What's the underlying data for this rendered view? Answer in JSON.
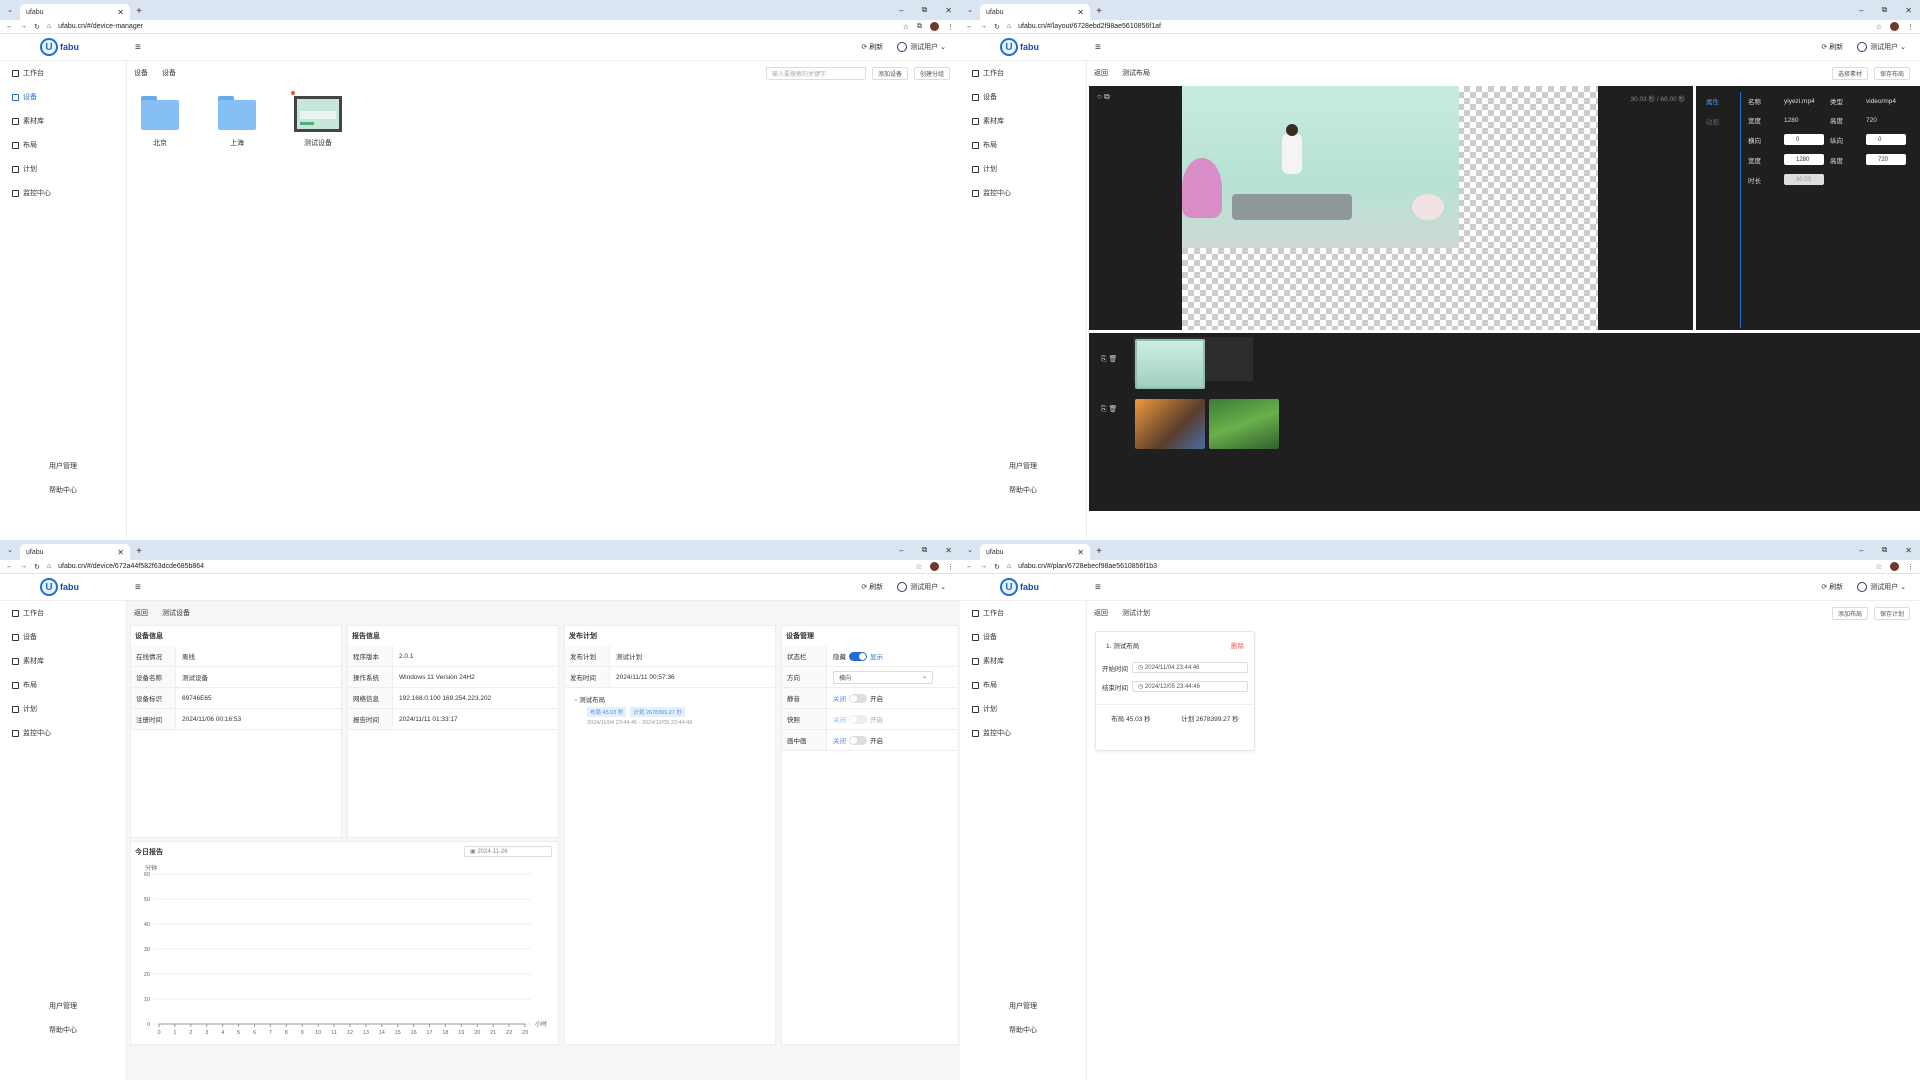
{
  "browser": {
    "tab_title": "ufabu",
    "window_controls": [
      "–",
      "⧉",
      "✕"
    ],
    "new_tab": "+"
  },
  "urls": {
    "w1": "ufabu.cn/#/device-manager",
    "w2": "ufabu.cn/#/layout/6728ebd2f98ae5610856f1af",
    "w3": "ufabu.cn/#/device/672a44f582f63dcde685b864",
    "w4": "ufabu.cn/#/plan/6728ebecf98ae5610856f1b3"
  },
  "app": {
    "logo_letter": "U",
    "logo_text": "fabu",
    "refresh": "刷新",
    "user": "测试用户",
    "sidebar": [
      "工作台",
      "设备",
      "素材库",
      "布局",
      "计划",
      "监控中心"
    ],
    "user_mgmt": "用户管理",
    "help": "帮助中心"
  },
  "w1": {
    "crumbs": [
      "设备",
      "设备"
    ],
    "search_placeholder": "输入要搜索的关键字",
    "add_device": "添加设备",
    "create_group": "创建分组",
    "items": [
      "北京",
      "上海",
      "测试设备"
    ]
  },
  "w2": {
    "crumbs": [
      "返回",
      "测试布局"
    ],
    "select_material": "选择素材",
    "save_layout": "保存布局",
    "play_time": "30.03 秒 / 60.00 秒",
    "tab_attr": "属性",
    "tab_anim": "动画",
    "props": {
      "name_k": "名称",
      "name_v": "yiyezi.mp4",
      "type_k": "类型",
      "type_v": "video/mp4",
      "w_k": "宽度",
      "w_v": "1280",
      "h_k": "高度",
      "h_v": "720",
      "x_k": "横向",
      "x_v": "0",
      "y_k": "纵向",
      "y_v": "0",
      "w2_k": "宽度",
      "w2_v": "1280",
      "h2_k": "高度",
      "h2_v": "720",
      "dur_k": "时长",
      "dur_v": "30.03"
    }
  },
  "w3": {
    "crumbs": [
      "返回",
      "测试设备"
    ],
    "device_info": {
      "title": "设备信息",
      "rows": [
        [
          "在线情况",
          "离线"
        ],
        [
          "设备名称",
          "测试设备"
        ],
        [
          "设备标识",
          "69746E65"
        ],
        [
          "注册时间",
          "2024/11/06 00:16:53"
        ]
      ]
    },
    "report_info": {
      "title": "报告信息",
      "rows": [
        [
          "程序版本",
          "2.0.1"
        ],
        [
          "操作系统",
          "Windows 11 Version 24H2"
        ],
        [
          "网络信息",
          "192.168.0.100 169.254.223.202"
        ],
        [
          "报告时间",
          "2024/11/11 01:33:17"
        ]
      ]
    },
    "publish": {
      "title": "发布计划",
      "rows": [
        [
          "发布计划",
          "测试计划"
        ],
        [
          "发布时间",
          "2024/11/11 00:57:36"
        ]
      ],
      "layout_name": "测试布局",
      "tag1": "布局 45.03 秒",
      "tag2": "计划 2678399.27 秒",
      "range": "2024/11/04 23:44:46 - 2024/12/05 23:44:46"
    },
    "manage": {
      "title": "设备管理",
      "status_k": "状态栏",
      "status_off": "隐藏",
      "status_on": "显示",
      "dir_k": "方向",
      "dir_v": "横向",
      "mute_k": "静音",
      "shot_k": "快照",
      "winmode_k": "画中画",
      "off": "关闭",
      "on": "开启"
    },
    "today": {
      "title": "今日报告",
      "date": "2024-11-26",
      "yunit": "分钟",
      "xunit": "小时"
    }
  },
  "w4": {
    "crumbs": [
      "返回",
      "测试计划"
    ],
    "add_layout": "添加布局",
    "save_plan": "保存计划",
    "card_title": "1. 测试布局",
    "delete": "删除",
    "start_k": "开始时间",
    "start_v": "2024/11/04 23:44:46",
    "end_k": "结束时间",
    "end_v": "2024/12/05 23:44:46",
    "layout_len": "布局 45.03 秒",
    "plan_len": "计划 2678399.27 秒"
  },
  "chart_data": {
    "type": "line",
    "title": "今日报告",
    "ylabel": "分钟",
    "xlabel": "小时",
    "ylim": [
      0,
      60
    ],
    "yticks": [
      0,
      10,
      20,
      30,
      40,
      50,
      60
    ],
    "x": [
      0,
      1,
      2,
      3,
      4,
      5,
      6,
      7,
      8,
      9,
      10,
      11,
      12,
      13,
      14,
      15,
      16,
      17,
      18,
      19,
      20,
      21,
      22,
      23
    ],
    "series": [
      {
        "values": [
          0,
          0,
          0,
          0,
          0,
          0,
          0,
          0,
          0,
          0,
          0,
          0,
          0,
          0,
          0,
          0,
          0,
          0,
          0,
          0,
          0,
          0,
          0,
          0
        ]
      }
    ]
  }
}
